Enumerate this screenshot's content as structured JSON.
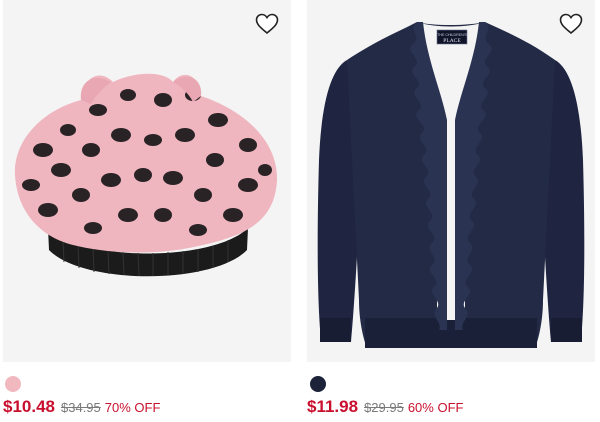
{
  "colors": {
    "sale_price": "#c8102e",
    "off_text": "#c8102e",
    "original_price": "#7a7a7a",
    "card_background": "#f4f4f4"
  },
  "products": [
    {
      "image_alt": "pink leopard faux fur beret with ears",
      "favorite_icon": "heart-outline-icon",
      "swatch_color": "#f2b8c0",
      "sale_price": "$10.48",
      "original_price": "$34.95",
      "discount": "70% OFF"
    },
    {
      "image_alt": "navy ruffle trim cardigan",
      "favorite_icon": "heart-outline-icon",
      "swatch_color": "#1c2238",
      "label_line1": "THE CHILDREN'S",
      "label_line2": "PLACE",
      "sale_price": "$11.98",
      "original_price": "$29.95",
      "discount": "60% OFF"
    }
  ]
}
